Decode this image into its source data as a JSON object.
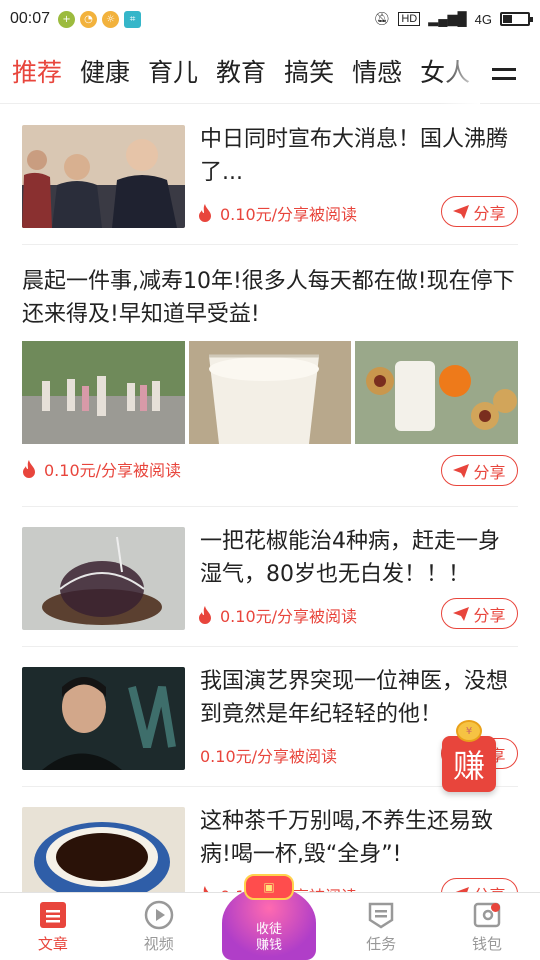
{
  "status_bar": {
    "time": "00:07",
    "network": "4G",
    "hd": "HD"
  },
  "tabs": [
    {
      "label": "推荐",
      "active": true
    },
    {
      "label": "健康"
    },
    {
      "label": "育儿"
    },
    {
      "label": "教育"
    },
    {
      "label": "搞笑"
    },
    {
      "label": "情感"
    },
    {
      "label": "女人"
    }
  ],
  "reward_text": "0.10元/分享被阅读",
  "share_label": "分享",
  "articles": [
    {
      "title": "中日同时宣布大消息！国人沸腾了..."
    },
    {
      "title": "晨起一件事,减寿10年!很多人每天都在做!现在停下还来得及!早知道早受益!"
    },
    {
      "title": "一把花椒能治4种病，赶走一身湿气，80岁也无白发！！！"
    },
    {
      "title": "我国演艺界突现一位神医，没想到竟然是年纪轻轻的他！"
    },
    {
      "title": "这种茶千万别喝,不养生还易致病!喝一杯,毁“全身”!"
    }
  ],
  "earn_badge": {
    "label": "赚",
    "coin": "¥"
  },
  "apprentice_button": {
    "line1": "收徒",
    "line2": "赚钱"
  },
  "bottom_nav": [
    {
      "label": "文章",
      "active": true
    },
    {
      "label": "视频"
    },
    {
      "label": "任务"
    },
    {
      "label": "钱包"
    }
  ],
  "colors": {
    "accent": "#e8453c",
    "inactive": "#999999"
  }
}
